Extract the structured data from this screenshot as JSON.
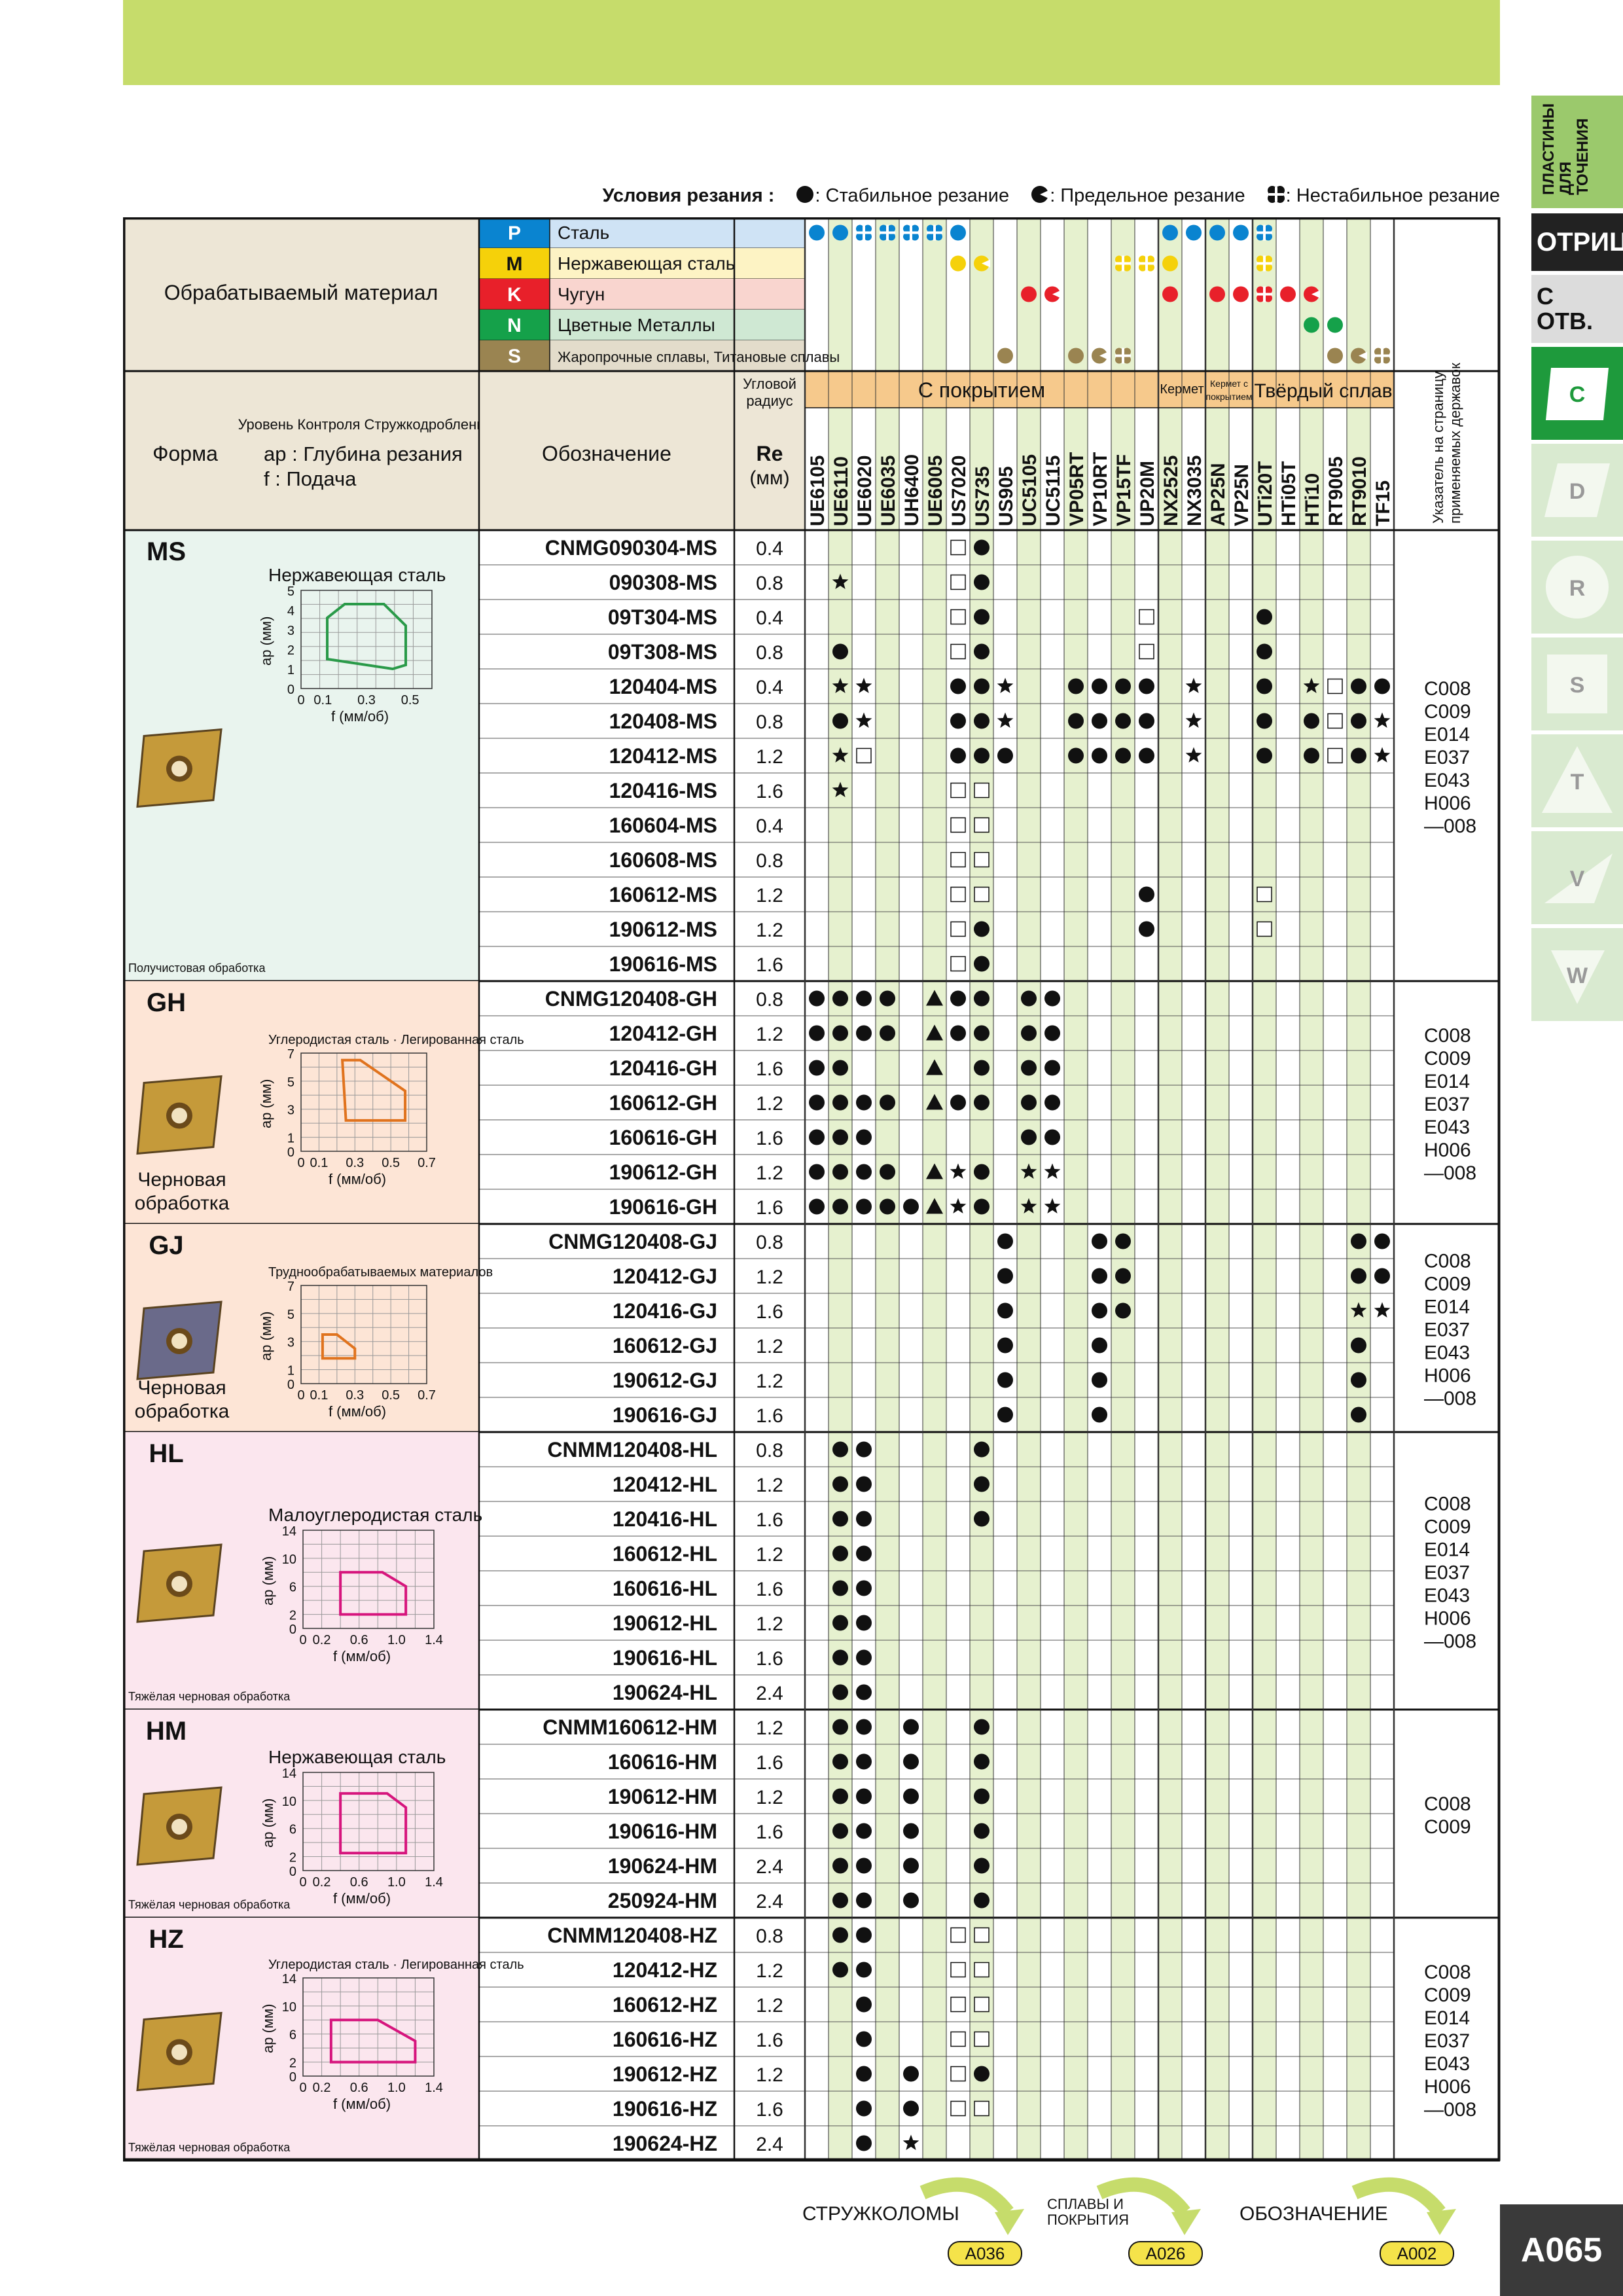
{
  "legend": {
    "title": "Условия резания :",
    "stable": ": Стабильное резание",
    "limit": ": Предельное резание",
    "unstable": ": Нестабильное резание"
  },
  "tabs": {
    "turning": "ПЛАСТИНЫ ДЛЯ ТОЧЕНИЯ",
    "negative": "ОТРИЦ.",
    "hole": "С ОТВ.",
    "shapes": [
      "C",
      "D",
      "R",
      "S",
      "T",
      "V",
      "W"
    ]
  },
  "header": {
    "material_title": "Обрабатываемый материал",
    "materials": [
      {
        "code": "P",
        "name": "Сталь",
        "color": "#0a84d0",
        "bg": "#cfe3f5"
      },
      {
        "code": "M",
        "name": "Нержавеющая сталь",
        "color": "#f5d10a",
        "bg": "#fdf3c4"
      },
      {
        "code": "K",
        "name": "Чугун",
        "color": "#e8202a",
        "bg": "#f9d5cf"
      },
      {
        "code": "N",
        "name": "Цветные Металлы",
        "color": "#15a14a",
        "bg": "#cfe8d3"
      },
      {
        "code": "S",
        "name": "Жаропрочные сплавы, Титановые сплавы",
        "color": "#9a8451",
        "bg": "#e3dccb"
      }
    ],
    "shape_title": "Форма",
    "chip_control": "Уровень Контроля Стружкодробления",
    "ap_label": "ap : Глубина резания",
    "f_label": "f : Подача",
    "designation": "Обозначение",
    "radius_title": "Угловой радиус",
    "re": "Re",
    "re_unit": "(мм)",
    "coated": "С покрытием",
    "cermet": "Кермет",
    "coated_cermet": "Кермет с покрытием",
    "carbide": "Твёрдый сплав",
    "holder_index": "Указатель на страницу применяемых державок"
  },
  "grades": [
    "UE6105",
    "UE6110",
    "UE6020",
    "UE6035",
    "UH6400",
    "UE6005",
    "US7020",
    "US735",
    "US905",
    "UC5105",
    "UC5115",
    "VP05RT",
    "VP10RT",
    "VP15TF",
    "UP20M",
    "NX2525",
    "NX3035",
    "AP25N",
    "VP25N",
    "UTi20T",
    "HTi05T",
    "HTi10",
    "RT9005",
    "RT9010",
    "TF15"
  ],
  "grade_material_marks": [
    "P.......................",
    "........................"
  ],
  "material_matrix": {
    "P": {
      "0": "s",
      "1": "s",
      "2": "u",
      "3": "u",
      "4": "u",
      "5": "u",
      "6": "s",
      "15": "s",
      "16": "s",
      "17": "s",
      "18": "s",
      "19": "u"
    },
    "M": {
      "6": "s",
      "7": "l",
      "13": "u",
      "14": "u",
      "15": "s",
      "19": "u"
    },
    "K": {
      "9": "s",
      "10": "l",
      "15": "s",
      "17": "s",
      "18": "s",
      "19": "u",
      "20": "s",
      "21": "l"
    },
    "N": {
      "21": "s",
      "22": "s"
    },
    "S": {
      "8": "s",
      "11": "s",
      "12": "l",
      "13": "u",
      "22": "s",
      "23": "l",
      "24": "u"
    }
  },
  "groups": [
    {
      "code": "MS",
      "chart_title": "Нержавеющая сталь",
      "ap_max": "5",
      "ap_ticks": [
        "0",
        "1",
        "2",
        "3",
        "4",
        "5"
      ],
      "f_ticks": [
        "0",
        "0.1",
        "0.3",
        "0.5"
      ],
      "f_unit": "f (мм/об)",
      "ap_unit": "ap (мм)",
      "usage": "Получистовая обработка",
      "color": "#e9f4ee",
      "shape_color": "#2a9a49",
      "pages": [
        "C008",
        "C009",
        "E014",
        "E037",
        "E043",
        "H006",
        "—008"
      ],
      "rows": [
        {
          "d": "CNMG090304-MS",
          "re": "0.4",
          "m": {
            "6": "q",
            "7": "d"
          }
        },
        {
          "d": "090308-MS",
          "re": "0.8",
          "m": {
            "1": "x",
            "6": "q",
            "7": "d"
          }
        },
        {
          "d": "09T304-MS",
          "re": "0.4",
          "m": {
            "6": "q",
            "7": "d",
            "14": "q",
            "19": "d"
          }
        },
        {
          "d": "09T308-MS",
          "re": "0.8",
          "m": {
            "1": "d",
            "6": "q",
            "7": "d",
            "14": "q",
            "19": "d"
          }
        },
        {
          "d": "120404-MS",
          "re": "0.4",
          "m": {
            "1": "x",
            "2": "x",
            "6": "d",
            "7": "d",
            "8": "x",
            "11": "d",
            "12": "d",
            "13": "d",
            "14": "d",
            "16": "x",
            "19": "d",
            "21": "x",
            "22": "q",
            "23": "d",
            "24": "d"
          }
        },
        {
          "d": "120408-MS",
          "re": "0.8",
          "m": {
            "1": "d",
            "2": "x",
            "6": "d",
            "7": "d",
            "8": "x",
            "11": "d",
            "12": "d",
            "13": "d",
            "14": "d",
            "16": "x",
            "19": "d",
            "21": "d",
            "22": "q",
            "23": "d",
            "24": "x"
          }
        },
        {
          "d": "120412-MS",
          "re": "1.2",
          "m": {
            "1": "x",
            "2": "q",
            "6": "d",
            "7": "d",
            "8": "d",
            "11": "d",
            "12": "d",
            "13": "d",
            "14": "d",
            "16": "x",
            "19": "d",
            "21": "d",
            "22": "q",
            "23": "d",
            "24": "x"
          }
        },
        {
          "d": "120416-MS",
          "re": "1.6",
          "m": {
            "1": "x",
            "6": "q",
            "7": "q"
          }
        },
        {
          "d": "160604-MS",
          "re": "0.4",
          "m": {
            "6": "q",
            "7": "q"
          }
        },
        {
          "d": "160608-MS",
          "re": "0.8",
          "m": {
            "6": "q",
            "7": "q"
          }
        },
        {
          "d": "160612-MS",
          "re": "1.2",
          "m": {
            "6": "q",
            "7": "q",
            "14": "d",
            "19": "q"
          }
        },
        {
          "d": "190612-MS",
          "re": "1.2",
          "m": {
            "6": "q",
            "7": "d",
            "14": "d",
            "19": "q"
          }
        },
        {
          "d": "190616-MS",
          "re": "1.6",
          "m": {
            "6": "q",
            "7": "d"
          }
        }
      ]
    },
    {
      "code": "GH",
      "chart_title": "Углеродистая сталь · Легированная сталь",
      "ap_max": "7",
      "ap_ticks": [
        "0",
        "1",
        "3",
        "5",
        "7"
      ],
      "f_ticks": [
        "0",
        "0.1",
        "0.3",
        "0.5",
        "0.7"
      ],
      "f_unit": "f (мм/об)",
      "ap_unit": "ap (мм)",
      "usage": "Черновая обработка",
      "color": "#fde5d6",
      "shape_color": "#e0731e",
      "pages": [
        "C008",
        "C009",
        "E014",
        "E037",
        "E043",
        "H006",
        "—008"
      ],
      "rows": [
        {
          "d": "CNMG120408-GH",
          "re": "0.8",
          "m": {
            "0": "d",
            "1": "d",
            "2": "d",
            "3": "d",
            "5": "t",
            "6": "d",
            "7": "d",
            "9": "d",
            "10": "d"
          }
        },
        {
          "d": "120412-GH",
          "re": "1.2",
          "m": {
            "0": "d",
            "1": "d",
            "2": "d",
            "3": "d",
            "5": "t",
            "6": "d",
            "7": "d",
            "9": "d",
            "10": "d"
          }
        },
        {
          "d": "120416-GH",
          "re": "1.6",
          "m": {
            "0": "d",
            "1": "d",
            "5": "t",
            "7": "d",
            "9": "d",
            "10": "d"
          }
        },
        {
          "d": "160612-GH",
          "re": "1.2",
          "m": {
            "0": "d",
            "1": "d",
            "2": "d",
            "3": "d",
            "5": "t",
            "6": "d",
            "7": "d",
            "9": "d",
            "10": "d"
          }
        },
        {
          "d": "160616-GH",
          "re": "1.6",
          "m": {
            "0": "d",
            "1": "d",
            "2": "d",
            "9": "d",
            "10": "d"
          }
        },
        {
          "d": "190612-GH",
          "re": "1.2",
          "m": {
            "0": "d",
            "1": "d",
            "2": "d",
            "3": "d",
            "5": "t",
            "6": "x",
            "7": "d",
            "9": "x",
            "10": "x"
          }
        },
        {
          "d": "190616-GH",
          "re": "1.6",
          "m": {
            "0": "d",
            "1": "d",
            "2": "d",
            "3": "d",
            "4": "d",
            "5": "t",
            "6": "x",
            "7": "d",
            "9": "x",
            "10": "x"
          }
        }
      ]
    },
    {
      "code": "GJ",
      "chart_title": "Труднообрабатываемых материалов",
      "ap_max": "7",
      "ap_ticks": [
        "0",
        "1",
        "3",
        "5",
        "7"
      ],
      "f_ticks": [
        "0",
        "0.1",
        "0.3",
        "0.5",
        "0.7"
      ],
      "f_unit": "f (мм/об)",
      "ap_unit": "ap (мм)",
      "usage": "Черновая обработка",
      "color": "#fde5d6",
      "shape_color": "#e0731e",
      "pages": [
        "C008",
        "C009",
        "E014",
        "E037",
        "E043",
        "H006",
        "—008"
      ],
      "rows": [
        {
          "d": "CNMG120408-GJ",
          "re": "0.8",
          "m": {
            "8": "d",
            "12": "d",
            "13": "d",
            "23": "d",
            "24": "d"
          }
        },
        {
          "d": "120412-GJ",
          "re": "1.2",
          "m": {
            "8": "d",
            "12": "d",
            "13": "d",
            "23": "d",
            "24": "d"
          }
        },
        {
          "d": "120416-GJ",
          "re": "1.6",
          "m": {
            "8": "d",
            "12": "d",
            "13": "d",
            "23": "x",
            "24": "x"
          }
        },
        {
          "d": "160612-GJ",
          "re": "1.2",
          "m": {
            "8": "d",
            "12": "d",
            "23": "d"
          }
        },
        {
          "d": "190612-GJ",
          "re": "1.2",
          "m": {
            "8": "d",
            "12": "d",
            "23": "d"
          }
        },
        {
          "d": "190616-GJ",
          "re": "1.6",
          "m": {
            "8": "d",
            "12": "d",
            "23": "d"
          }
        }
      ]
    },
    {
      "code": "HL",
      "chart_title": "Малоуглеродистая сталь",
      "ap_max": "14",
      "ap_ticks": [
        "0",
        "2",
        "6",
        "10",
        "14"
      ],
      "f_ticks": [
        "0",
        "0.2",
        "0.6",
        "1.0",
        "1.4"
      ],
      "f_unit": "f (мм/об)",
      "ap_unit": "ap (мм)",
      "usage": "Тяжёлая черновая обработка",
      "color": "#fbe6ee",
      "shape_color": "#d6157d",
      "pages": [
        "C008",
        "C009",
        "E014",
        "E037",
        "E043",
        "H006",
        "—008"
      ],
      "rows": [
        {
          "d": "CNMM120408-HL",
          "re": "0.8",
          "m": {
            "1": "d",
            "2": "d",
            "7": "d"
          }
        },
        {
          "d": "120412-HL",
          "re": "1.2",
          "m": {
            "1": "d",
            "2": "d",
            "7": "d"
          }
        },
        {
          "d": "120416-HL",
          "re": "1.6",
          "m": {
            "1": "d",
            "2": "d",
            "7": "d"
          }
        },
        {
          "d": "160612-HL",
          "re": "1.2",
          "m": {
            "1": "d",
            "2": "d"
          }
        },
        {
          "d": "160616-HL",
          "re": "1.6",
          "m": {
            "1": "d",
            "2": "d"
          }
        },
        {
          "d": "190612-HL",
          "re": "1.2",
          "m": {
            "1": "d",
            "2": "d"
          }
        },
        {
          "d": "190616-HL",
          "re": "1.6",
          "m": {
            "1": "d",
            "2": "d"
          }
        },
        {
          "d": "190624-HL",
          "re": "2.4",
          "m": {
            "1": "d",
            "2": "d"
          }
        }
      ]
    },
    {
      "code": "HM",
      "chart_title": "Нержавеющая сталь",
      "ap_max": "14",
      "ap_ticks": [
        "0",
        "2",
        "6",
        "10",
        "14"
      ],
      "f_ticks": [
        "0",
        "0.2",
        "0.6",
        "1.0",
        "1.4"
      ],
      "f_unit": "f (мм/об)",
      "ap_unit": "ap (мм)",
      "usage": "Тяжёлая черновая обработка",
      "color": "#fbe6ee",
      "shape_color": "#d6157d",
      "pages": [
        "C008",
        "C009"
      ],
      "rows": [
        {
          "d": "CNMM160612-HM",
          "re": "1.2",
          "m": {
            "1": "d",
            "2": "d",
            "4": "d",
            "7": "d"
          }
        },
        {
          "d": "160616-HM",
          "re": "1.6",
          "m": {
            "1": "d",
            "2": "d",
            "4": "d",
            "7": "d"
          }
        },
        {
          "d": "190612-HM",
          "re": "1.2",
          "m": {
            "1": "d",
            "2": "d",
            "4": "d",
            "7": "d"
          }
        },
        {
          "d": "190616-HM",
          "re": "1.6",
          "m": {
            "1": "d",
            "2": "d",
            "4": "d",
            "7": "d"
          }
        },
        {
          "d": "190624-HM",
          "re": "2.4",
          "m": {
            "1": "d",
            "2": "d",
            "4": "d",
            "7": "d"
          }
        },
        {
          "d": "250924-HM",
          "re": "2.4",
          "m": {
            "1": "d",
            "2": "d",
            "4": "d",
            "7": "d"
          }
        }
      ]
    },
    {
      "code": "HZ",
      "chart_title": "Углеродистая сталь · Легированная сталь",
      "ap_max": "14",
      "ap_ticks": [
        "0",
        "2",
        "6",
        "10",
        "14"
      ],
      "f_ticks": [
        "0",
        "0.2",
        "0.6",
        "1.0",
        "1.4"
      ],
      "f_unit": "f (мм/об)",
      "ap_unit": "ap (мм)",
      "usage": "Тяжёлая черновая обработка",
      "color": "#fbe6ee",
      "shape_color": "#d6157d",
      "pages": [
        "C008",
        "C009",
        "E014",
        "E037",
        "E043",
        "H006",
        "—008"
      ],
      "rows": [
        {
          "d": "CNMM120408-HZ",
          "re": "0.8",
          "m": {
            "1": "d",
            "2": "d",
            "6": "q",
            "7": "q"
          }
        },
        {
          "d": "120412-HZ",
          "re": "1.2",
          "m": {
            "1": "d",
            "2": "d",
            "6": "q",
            "7": "q"
          }
        },
        {
          "d": "160612-HZ",
          "re": "1.2",
          "m": {
            "2": "d",
            "6": "q",
            "7": "q"
          }
        },
        {
          "d": "160616-HZ",
          "re": "1.6",
          "m": {
            "2": "d",
            "6": "q",
            "7": "q"
          }
        },
        {
          "d": "190612-HZ",
          "re": "1.2",
          "m": {
            "2": "d",
            "4": "d",
            "6": "q",
            "7": "d"
          }
        },
        {
          "d": "190616-HZ",
          "re": "1.6",
          "m": {
            "2": "d",
            "4": "d",
            "6": "q",
            "7": "q"
          }
        },
        {
          "d": "190624-HZ",
          "re": "2.4",
          "m": {
            "2": "d",
            "4": "x"
          }
        }
      ]
    }
  ],
  "footer": {
    "chipbreakers": "СТРУЖКОЛОМЫ",
    "chipbreakers_page": "A036",
    "grades": "СПЛАВЫ И ПОКРЫТИЯ",
    "grades_page": "A026",
    "designation": "ОБОЗНАЧЕНИЕ",
    "designation_page": "A002",
    "page": "A065"
  }
}
